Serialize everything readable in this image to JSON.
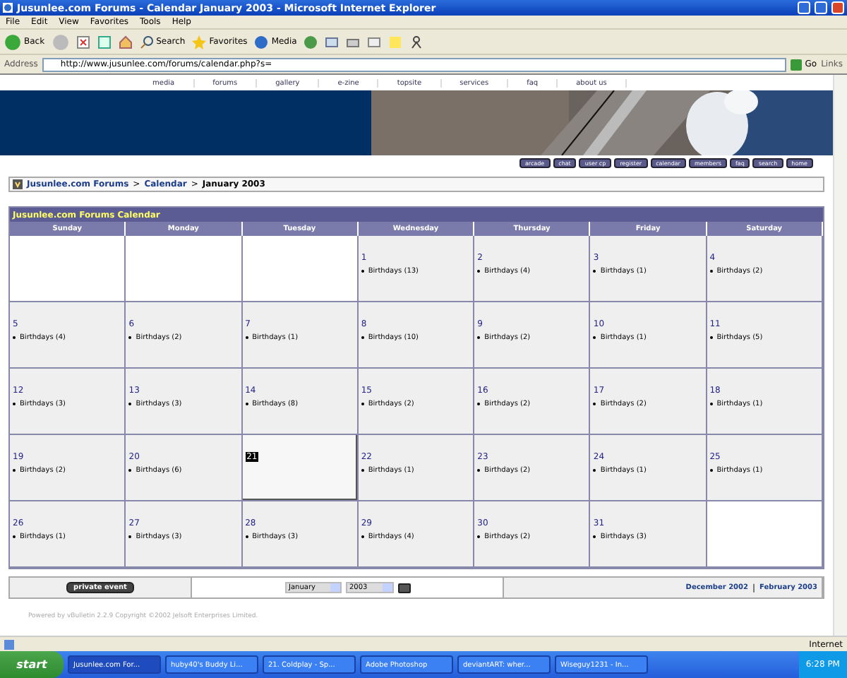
{
  "window": {
    "title": "Jusunlee.com Forums - Calendar January 2003 - Microsoft Internet Explorer"
  },
  "menu": [
    "File",
    "Edit",
    "View",
    "Favorites",
    "Tools",
    "Help"
  ],
  "toolbar": [
    {
      "kind": "back",
      "label": "Back"
    },
    {
      "kind": "forward"
    },
    {
      "kind": "stop"
    },
    {
      "kind": "refresh"
    },
    {
      "kind": "home"
    },
    {
      "kind": "search",
      "label": "Search"
    },
    {
      "kind": "favorites",
      "label": "Favorites"
    },
    {
      "kind": "media",
      "label": "Media"
    },
    {
      "kind": "history"
    },
    {
      "kind": "mail"
    },
    {
      "kind": "print"
    },
    {
      "kind": "edit"
    },
    {
      "kind": "note"
    },
    {
      "kind": "messenger"
    }
  ],
  "address": {
    "label": "Address",
    "value": "http://www.jusunlee.com/forums/calendar.php?s=",
    "go": "Go",
    "links": "Links"
  },
  "nav_links": [
    "media",
    "forums",
    "gallery",
    "e-zine",
    "topsite",
    "services",
    "faq",
    "about us"
  ],
  "nav_buttons": [
    "arcade",
    "chat",
    "user cp",
    "register",
    "calendar",
    "members",
    "faq",
    "search",
    "home"
  ],
  "breadcrumb": [
    "Jusunlee.com Forums",
    "Calendar",
    "January 2003"
  ],
  "breadcrumb_separators": [
    ">",
    ">"
  ],
  "calendar": {
    "title": "Jusunlee.com Forums Calendar",
    "weekdays": [
      "Sunday",
      "Monday",
      "Tuesday",
      "Wednesday",
      "Thursday",
      "Friday",
      "Saturday"
    ],
    "weeks": [
      [
        {
          "kind": "empty"
        },
        {
          "kind": "empty"
        },
        {
          "kind": "empty"
        },
        {
          "kind": "day",
          "day": "1",
          "event": "Birthdays (13)"
        },
        {
          "kind": "day",
          "day": "2",
          "event": "Birthdays (4)"
        },
        {
          "kind": "day",
          "day": "3",
          "event": "Birthdays (1)"
        },
        {
          "kind": "day",
          "day": "4",
          "event": "Birthdays (2)"
        }
      ],
      [
        {
          "kind": "day",
          "day": "5",
          "event": "Birthdays (4)"
        },
        {
          "kind": "day",
          "day": "6",
          "event": "Birthdays (2)"
        },
        {
          "kind": "day",
          "day": "7",
          "event": "Birthdays (1)"
        },
        {
          "kind": "day",
          "day": "8",
          "event": "Birthdays (10)"
        },
        {
          "kind": "day",
          "day": "9",
          "event": "Birthdays (2)"
        },
        {
          "kind": "day",
          "day": "10",
          "event": "Birthdays (1)"
        },
        {
          "kind": "day",
          "day": "11",
          "event": "Birthdays (5)"
        }
      ],
      [
        {
          "kind": "day",
          "day": "12",
          "event": "Birthdays (3)"
        },
        {
          "kind": "day",
          "day": "13",
          "event": "Birthdays (3)"
        },
        {
          "kind": "day",
          "day": "14",
          "event": "Birthdays (8)"
        },
        {
          "kind": "day",
          "day": "15",
          "event": "Birthdays (2)"
        },
        {
          "kind": "day",
          "day": "16",
          "event": "Birthdays (2)"
        },
        {
          "kind": "day",
          "day": "17",
          "event": "Birthdays (2)"
        },
        {
          "kind": "day",
          "day": "18",
          "event": "Birthdays (1)"
        }
      ],
      [
        {
          "kind": "day",
          "day": "19",
          "event": "Birthdays (2)"
        },
        {
          "kind": "day",
          "day": "20",
          "event": "Birthdays (6)"
        },
        {
          "kind": "today",
          "day": "21"
        },
        {
          "kind": "day",
          "day": "22",
          "event": "Birthdays (1)"
        },
        {
          "kind": "day",
          "day": "23",
          "event": "Birthdays (2)"
        },
        {
          "kind": "day",
          "day": "24",
          "event": "Birthdays (1)"
        },
        {
          "kind": "day",
          "day": "25",
          "event": "Birthdays (1)"
        }
      ],
      [
        {
          "kind": "day",
          "day": "26",
          "event": "Birthdays (1)"
        },
        {
          "kind": "day",
          "day": "27",
          "event": "Birthdays (3)"
        },
        {
          "kind": "day",
          "day": "28",
          "event": "Birthdays (3)"
        },
        {
          "kind": "day",
          "day": "29",
          "event": "Birthdays (4)"
        },
        {
          "kind": "day",
          "day": "30",
          "event": "Birthdays (2)"
        },
        {
          "kind": "day",
          "day": "31",
          "event": "Birthdays (3)"
        },
        {
          "kind": "empty"
        }
      ]
    ]
  },
  "footer": {
    "private_event": "private event",
    "month": "January",
    "year": "2003",
    "prev": "December 2002",
    "separator": "|",
    "next": "February 2003"
  },
  "powered": {
    "prefix": "Powered by ",
    "link": "vBulletin 2.2.9",
    "suffix": " Copyright ©2002 Jelsoft Enterprises Limited."
  },
  "status_bar": {
    "zone": "Internet"
  },
  "taskbar": {
    "start": "start",
    "items": [
      {
        "label": "Jusunlee.com For...",
        "selected": true
      },
      {
        "label": "huby40's Buddy Li...",
        "selected": false
      },
      {
        "label": "21. Coldplay - Sp...",
        "selected": false
      },
      {
        "label": "Adobe Photoshop",
        "selected": false
      },
      {
        "label": "deviantART: wher...",
        "selected": false
      },
      {
        "label": "Wiseguy1231 - In...",
        "selected": false
      }
    ],
    "clock": "6:28 PM"
  }
}
